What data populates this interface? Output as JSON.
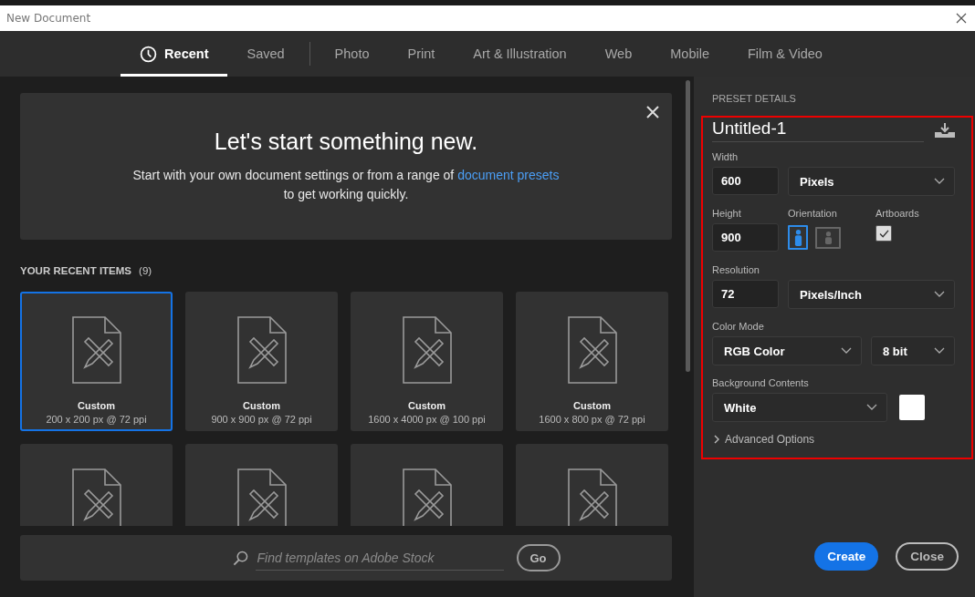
{
  "window": {
    "title": "New Document"
  },
  "tabs": [
    {
      "label": "Recent",
      "selected": true,
      "kind": "history"
    },
    {
      "label": "Saved",
      "selected": false,
      "kind": "plain"
    },
    {
      "label": "Photo",
      "selected": false,
      "kind": "category"
    },
    {
      "label": "Print",
      "selected": false,
      "kind": "category"
    },
    {
      "label": "Art & Illustration",
      "selected": false,
      "kind": "category"
    },
    {
      "label": "Web",
      "selected": false,
      "kind": "category"
    },
    {
      "label": "Mobile",
      "selected": false,
      "kind": "category"
    },
    {
      "label": "Film & Video",
      "selected": false,
      "kind": "category"
    }
  ],
  "welcome": {
    "heading": "Let's start something new.",
    "text_before": "Start with your own document settings or from a range of",
    "link": "document presets",
    "text_after": "to get working quickly."
  },
  "recent": {
    "heading": "YOUR RECENT ITEMS",
    "count": "(9)",
    "items": [
      {
        "name": "Custom",
        "size": "200 x 200 px @ 72 ppi",
        "selected": true
      },
      {
        "name": "Custom",
        "size": "900 x 900 px @ 72 ppi",
        "selected": false
      },
      {
        "name": "Custom",
        "size": "1600 x 4000 px @ 100 ppi",
        "selected": false
      },
      {
        "name": "Custom",
        "size": "1600 x 800 px @ 72 ppi",
        "selected": false
      },
      {
        "selected": false
      },
      {
        "selected": false
      },
      {
        "selected": false
      },
      {
        "selected": false
      }
    ]
  },
  "search": {
    "placeholder": "Find templates on Adobe Stock",
    "button": "Go"
  },
  "preset_details": {
    "heading": "PRESET DETAILS",
    "highlighted": true,
    "name": "Untitled-1",
    "width": {
      "label": "Width",
      "value": "600",
      "unit": "Pixels"
    },
    "height": {
      "label": "Height",
      "value": "900"
    },
    "orientation": {
      "label": "Orientation",
      "portrait_selected": true,
      "landscape_selected": false
    },
    "artboards": {
      "label": "Artboards",
      "checked": true
    },
    "resolution": {
      "label": "Resolution",
      "value": "72",
      "unit": "Pixels/Inch"
    },
    "color_mode": {
      "label": "Color Mode",
      "mode": "RGB Color",
      "depth": "8 bit"
    },
    "background": {
      "label": "Background Contents",
      "value": "White",
      "color": "#ffffff"
    },
    "advanced": {
      "label": "Advanced Options",
      "expanded": false
    }
  },
  "buttons": [
    {
      "label": "Create",
      "kind": "primary"
    },
    {
      "label": "Close",
      "kind": "secondary"
    }
  ]
}
